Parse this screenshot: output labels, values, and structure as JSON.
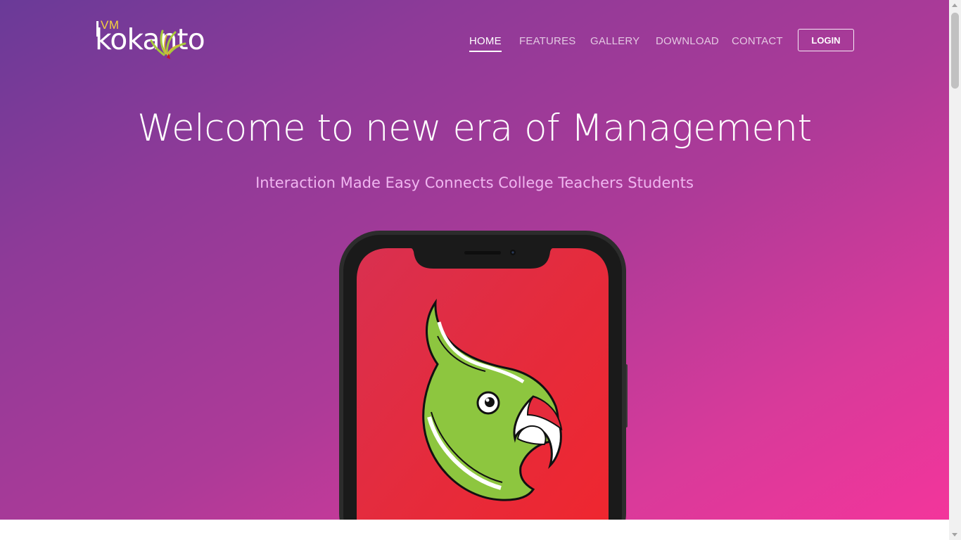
{
  "brand": {
    "prefix": "VM",
    "name": "kokanto",
    "colors": {
      "prefix": "#f4d23c",
      "burst_green": "#a7c83c",
      "burst_red": "#c8102e"
    }
  },
  "nav": {
    "items": [
      {
        "label": "HOME",
        "active": true
      },
      {
        "label": "FEATURES",
        "active": false
      },
      {
        "label": "GALLERY",
        "active": false
      },
      {
        "label": "DOWNLOAD",
        "active": false
      },
      {
        "label": "CONTACT",
        "active": false
      }
    ],
    "login_label": "LOGIN"
  },
  "hero": {
    "title": "Welcome to new era of Management",
    "subtitle": "Interaction Made Easy Connects College Teachers Students",
    "colors": {
      "gradient_start": "#6a3a98",
      "gradient_end": "#f3359b",
      "subtitle": "#f0b6f0"
    }
  },
  "phone": {
    "screen_icon": "parrot-logo-icon",
    "colors": {
      "screen": "#e52b3c",
      "parrot_body": "#8dc63f",
      "beak_stripe": "#e52b3c"
    }
  }
}
